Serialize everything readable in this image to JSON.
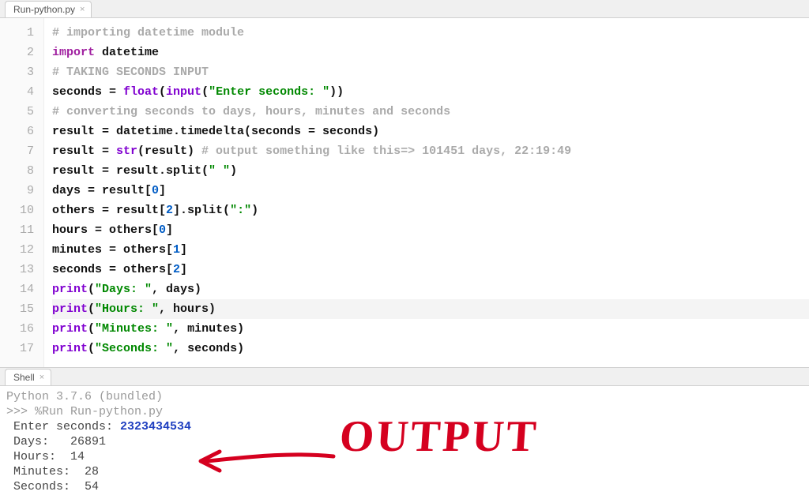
{
  "editor_tab": {
    "label": "Run-python.py"
  },
  "code_lines": [
    {
      "n": 1,
      "tokens": [
        {
          "t": "# importing datetime module",
          "c": "c-comment"
        }
      ]
    },
    {
      "n": 2,
      "tokens": [
        {
          "t": "import",
          "c": "c-kw"
        },
        {
          "t": " datetime",
          "c": "c-plain"
        }
      ]
    },
    {
      "n": 3,
      "tokens": [
        {
          "t": "# TAKING SECONDS INPUT",
          "c": "c-comment"
        }
      ]
    },
    {
      "n": 4,
      "tokens": [
        {
          "t": "seconds = ",
          "c": "c-plain"
        },
        {
          "t": "float",
          "c": "c-builtin"
        },
        {
          "t": "(",
          "c": "c-plain"
        },
        {
          "t": "input",
          "c": "c-builtin"
        },
        {
          "t": "(",
          "c": "c-plain"
        },
        {
          "t": "\"Enter seconds: \"",
          "c": "c-str"
        },
        {
          "t": "))",
          "c": "c-plain"
        }
      ]
    },
    {
      "n": 5,
      "tokens": [
        {
          "t": "# converting seconds to days, hours, minutes and seconds",
          "c": "c-comment"
        }
      ]
    },
    {
      "n": 6,
      "tokens": [
        {
          "t": "result = datetime.timedelta(seconds = seconds)",
          "c": "c-plain"
        }
      ]
    },
    {
      "n": 7,
      "tokens": [
        {
          "t": "result = ",
          "c": "c-plain"
        },
        {
          "t": "str",
          "c": "c-builtin"
        },
        {
          "t": "(result) ",
          "c": "c-plain"
        },
        {
          "t": "# output something like this=> 101451 days, 22:19:49",
          "c": "c-comment"
        }
      ]
    },
    {
      "n": 8,
      "tokens": [
        {
          "t": "result = result.split(",
          "c": "c-plain"
        },
        {
          "t": "\" \"",
          "c": "c-str"
        },
        {
          "t": ")",
          "c": "c-plain"
        }
      ]
    },
    {
      "n": 9,
      "tokens": [
        {
          "t": "days = result[",
          "c": "c-plain"
        },
        {
          "t": "0",
          "c": "c-num"
        },
        {
          "t": "]",
          "c": "c-plain"
        }
      ]
    },
    {
      "n": 10,
      "tokens": [
        {
          "t": "others = result[",
          "c": "c-plain"
        },
        {
          "t": "2",
          "c": "c-num"
        },
        {
          "t": "].split(",
          "c": "c-plain"
        },
        {
          "t": "\":\"",
          "c": "c-str"
        },
        {
          "t": ")",
          "c": "c-plain"
        }
      ]
    },
    {
      "n": 11,
      "tokens": [
        {
          "t": "hours = others[",
          "c": "c-plain"
        },
        {
          "t": "0",
          "c": "c-num"
        },
        {
          "t": "]",
          "c": "c-plain"
        }
      ]
    },
    {
      "n": 12,
      "tokens": [
        {
          "t": "minutes = others[",
          "c": "c-plain"
        },
        {
          "t": "1",
          "c": "c-num"
        },
        {
          "t": "]",
          "c": "c-plain"
        }
      ]
    },
    {
      "n": 13,
      "tokens": [
        {
          "t": "seconds = others[",
          "c": "c-plain"
        },
        {
          "t": "2",
          "c": "c-num"
        },
        {
          "t": "]",
          "c": "c-plain"
        }
      ]
    },
    {
      "n": 14,
      "tokens": [
        {
          "t": "print",
          "c": "c-builtin"
        },
        {
          "t": "(",
          "c": "c-plain"
        },
        {
          "t": "\"Days: \"",
          "c": "c-str"
        },
        {
          "t": ", days)",
          "c": "c-plain"
        }
      ]
    },
    {
      "n": 15,
      "current": true,
      "tokens": [
        {
          "t": "print",
          "c": "c-builtin"
        },
        {
          "t": "(",
          "c": "c-plain"
        },
        {
          "t": "\"Hours: \"",
          "c": "c-str"
        },
        {
          "t": ", hours)",
          "c": "c-plain"
        }
      ]
    },
    {
      "n": 16,
      "tokens": [
        {
          "t": "print",
          "c": "c-builtin"
        },
        {
          "t": "(",
          "c": "c-plain"
        },
        {
          "t": "\"Minutes: \"",
          "c": "c-str"
        },
        {
          "t": ", minutes)",
          "c": "c-plain"
        }
      ]
    },
    {
      "n": 17,
      "tokens": [
        {
          "t": "print",
          "c": "c-builtin"
        },
        {
          "t": "(",
          "c": "c-plain"
        },
        {
          "t": "\"Seconds: \"",
          "c": "c-str"
        },
        {
          "t": ", seconds)",
          "c": "c-plain"
        }
      ]
    }
  ],
  "shell_tab": {
    "label": "Shell"
  },
  "shell": {
    "version_line": "Python 3.7.6 (bundled)",
    "prompt": ">>> ",
    "run_cmd": "%Run Run-python.py",
    "prompt_label": " Enter seconds: ",
    "user_input": "2323434534",
    "out_days": " Days:   26891",
    "out_hours": " Hours:  14",
    "out_minutes": " Minutes:  28",
    "out_seconds": " Seconds:  54"
  },
  "annotation": {
    "text": "OUTPUT"
  }
}
